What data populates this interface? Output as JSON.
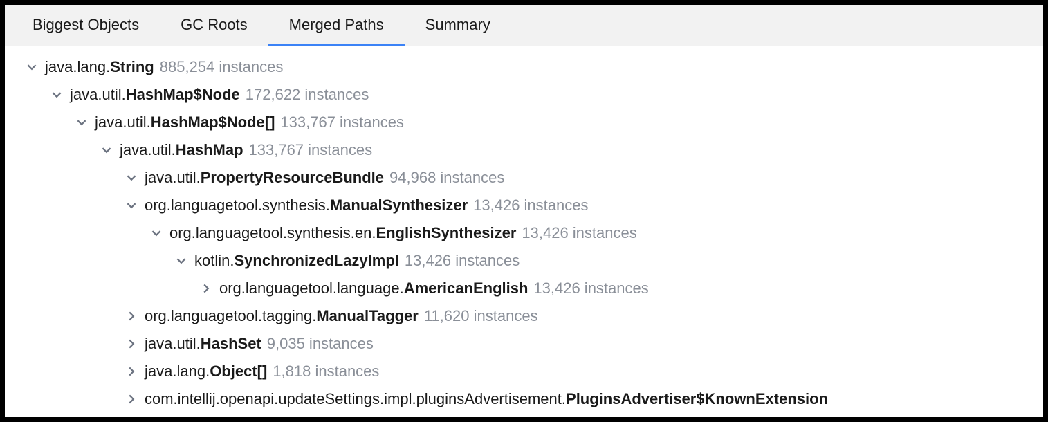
{
  "tabs": [
    {
      "label": "Biggest Objects",
      "active": false
    },
    {
      "label": "GC Roots",
      "active": false
    },
    {
      "label": "Merged Paths",
      "active": true
    },
    {
      "label": "Summary",
      "active": false
    }
  ],
  "rows": [
    {
      "indent": 0,
      "expanded": true,
      "pkg": "java.lang.",
      "cls": "String",
      "count": "885,254 instances"
    },
    {
      "indent": 1,
      "expanded": true,
      "pkg": "java.util.",
      "cls": "HashMap$Node",
      "count": "172,622 instances"
    },
    {
      "indent": 2,
      "expanded": true,
      "pkg": "java.util.",
      "cls": "HashMap$Node[]",
      "count": "133,767 instances"
    },
    {
      "indent": 3,
      "expanded": true,
      "pkg": "java.util.",
      "cls": "HashMap",
      "count": "133,767 instances"
    },
    {
      "indent": 4,
      "expanded": true,
      "pkg": "java.util.",
      "cls": "PropertyResourceBundle",
      "count": "94,968 instances"
    },
    {
      "indent": 4,
      "expanded": true,
      "pkg": "org.languagetool.synthesis.",
      "cls": "ManualSynthesizer",
      "count": "13,426 instances"
    },
    {
      "indent": 5,
      "expanded": true,
      "pkg": "org.languagetool.synthesis.en.",
      "cls": "EnglishSynthesizer",
      "count": "13,426 instances"
    },
    {
      "indent": 6,
      "expanded": true,
      "pkg": "kotlin.",
      "cls": "SynchronizedLazyImpl",
      "count": "13,426 instances"
    },
    {
      "indent": 7,
      "expanded": false,
      "pkg": "org.languagetool.language.",
      "cls": "AmericanEnglish",
      "count": "13,426 instances"
    },
    {
      "indent": 4,
      "expanded": false,
      "pkg": "org.languagetool.tagging.",
      "cls": "ManualTagger",
      "count": "11,620 instances"
    },
    {
      "indent": 4,
      "expanded": false,
      "pkg": "java.util.",
      "cls": "HashSet",
      "count": "9,035 instances"
    },
    {
      "indent": 4,
      "expanded": false,
      "pkg": "java.lang.",
      "cls": "Object[]",
      "count": "1,818 instances"
    },
    {
      "indent": 4,
      "expanded": false,
      "pkg": "com.intellij.openapi.updateSettings.impl.pluginsAdvertisement.",
      "cls": "PluginsAdvertiser$KnownExtension",
      "count": ""
    }
  ]
}
